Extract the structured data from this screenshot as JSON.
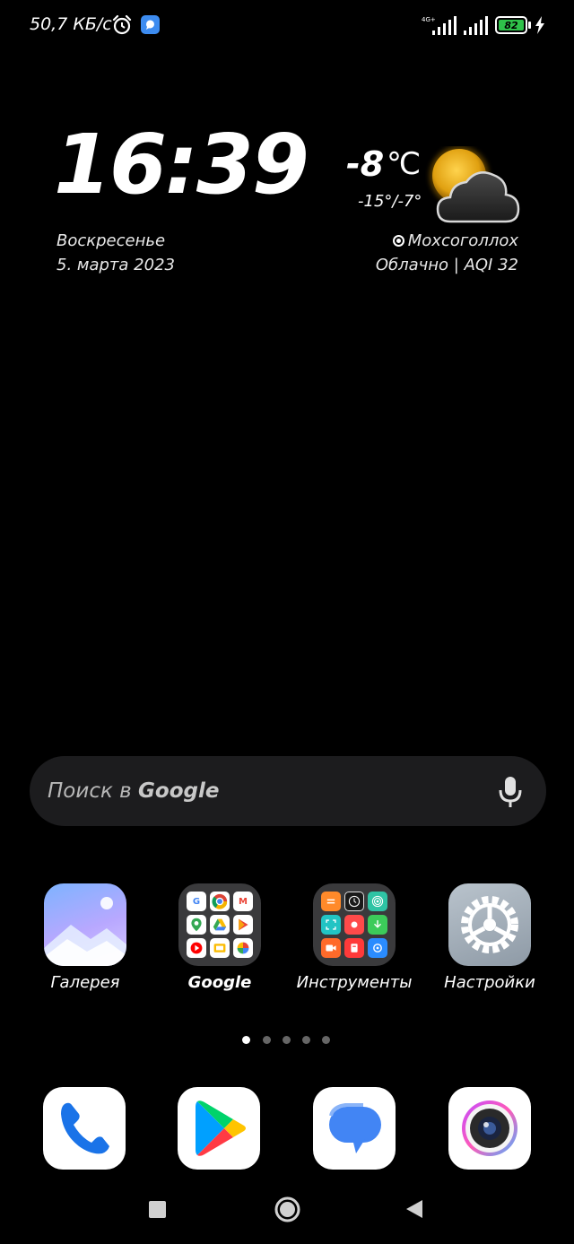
{
  "status_bar": {
    "net_speed": "50,7 КБ/с",
    "network_type": "4G+",
    "battery_level": "82",
    "icons": [
      "alarm-icon",
      "app-notification-icon",
      "signal-icon",
      "battery-icon",
      "charging-icon"
    ]
  },
  "clock": {
    "time": "16:39",
    "day": "Воскресенье",
    "date": "5. марта 2023"
  },
  "weather": {
    "temperature": "-8",
    "unit": "℃",
    "range": "-15°/-7°",
    "location": "Мохсоголлох",
    "condition": "Облачно | AQI 32",
    "icon": "partly-cloudy-icon"
  },
  "search": {
    "placeholder_prefix": "Поиск в ",
    "placeholder_brand": "Google"
  },
  "apps": [
    {
      "label": "Галерея",
      "icon": "gallery-icon"
    },
    {
      "label": "Google",
      "icon": "google-folder-icon"
    },
    {
      "label": "Инструменты",
      "icon": "tools-folder-icon"
    },
    {
      "label": "Настройки",
      "icon": "settings-icon"
    }
  ],
  "pages": {
    "count": 5,
    "active": 0
  },
  "dock": [
    {
      "icon": "phone-icon"
    },
    {
      "icon": "play-store-icon"
    },
    {
      "icon": "messages-icon"
    },
    {
      "icon": "camera-icon"
    }
  ],
  "colors": {
    "background": "#000000",
    "battery_fill": "#2fc24a",
    "search_bar": "#1c1c1e",
    "folder": "#3a3a3c"
  }
}
